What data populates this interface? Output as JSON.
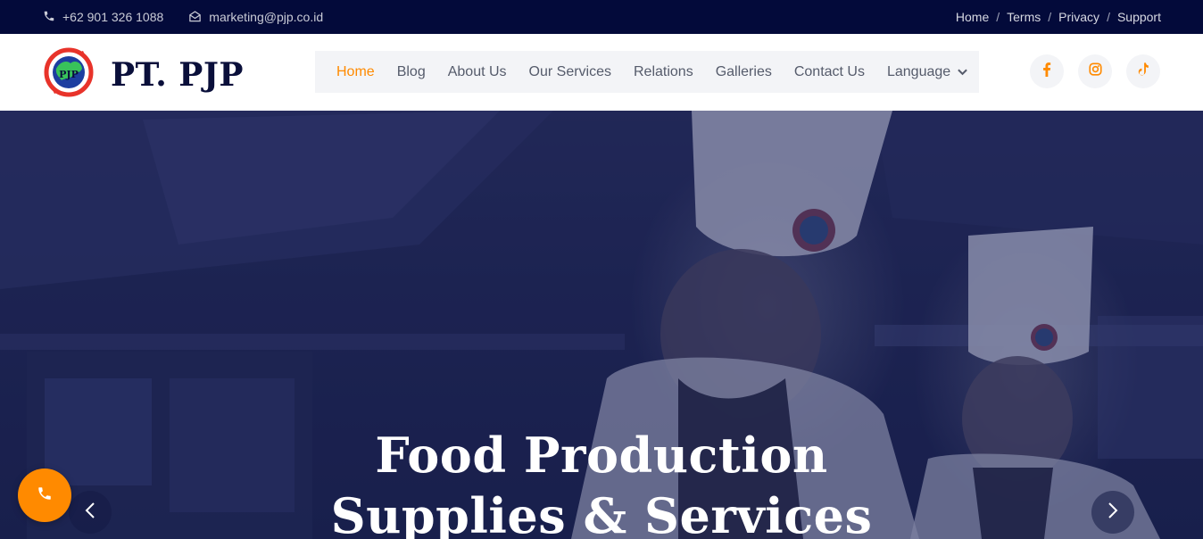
{
  "topbar": {
    "phone": "+62 901 326 1088",
    "email": "marketing@pjp.co.id",
    "links": [
      "Home",
      "Terms",
      "Privacy",
      "Support"
    ],
    "separator": "/"
  },
  "header": {
    "brand": "PT. PJP",
    "logo_text": "PJP",
    "nav": [
      {
        "label": "Home",
        "active": true
      },
      {
        "label": "Blog"
      },
      {
        "label": "About Us"
      },
      {
        "label": "Our Services"
      },
      {
        "label": "Relations"
      },
      {
        "label": "Galleries"
      },
      {
        "label": "Contact Us"
      },
      {
        "label": "Language"
      }
    ],
    "socials": [
      "facebook-icon",
      "instagram-icon",
      "tiktok-icon"
    ]
  },
  "hero": {
    "title_line1": "Food Production",
    "title_line2": "Supplies & Services"
  },
  "colors": {
    "topbar_bg": "#030a3a",
    "accent": "#ff8a00",
    "brand_text": "#0a0f3a",
    "nav_bg": "#f3f4f7"
  }
}
